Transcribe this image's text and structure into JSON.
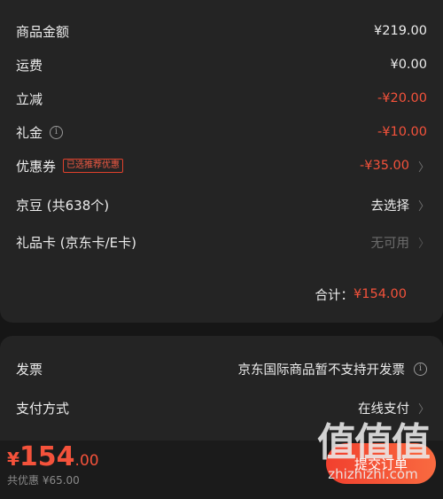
{
  "summary": {
    "rows": [
      {
        "label": "商品金额",
        "value": "¥219.00"
      },
      {
        "label": "运费",
        "value": "¥0.00"
      },
      {
        "label": "立减",
        "value": "-¥20.00"
      },
      {
        "label": "礼金",
        "value": "-¥10.00"
      },
      {
        "label": "优惠券",
        "tag": "已选推荐优惠",
        "value": "-¥35.00"
      },
      {
        "label": "京豆 (共638个)",
        "value": "去选择"
      },
      {
        "label": "礼品卡 (京东卡/E卡)",
        "value": "无可用"
      }
    ],
    "total_label": "合计：",
    "total_value": "¥154.00"
  },
  "invoice": {
    "label": "发票",
    "value": "京东国际商品暂不支持开发票"
  },
  "payment": {
    "label": "支付方式",
    "value": "在线支付"
  },
  "footer": {
    "currency": "¥",
    "price_int": "154",
    "price_dec": ".00",
    "savings": "共优惠 ¥65.00",
    "submit_label": "提交订单"
  },
  "watermark": {
    "big": "值值值",
    "small": "zhizhizhi.com"
  },
  "colors": {
    "accent": "#f4523b",
    "background": "#161616",
    "card": "#242424"
  }
}
